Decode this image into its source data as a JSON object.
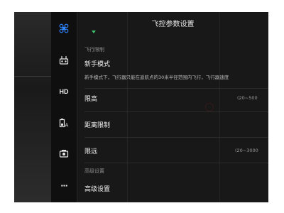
{
  "header": {
    "title": "飞控参数设置"
  },
  "sidebar": {
    "items": [
      {
        "icon": "drone-icon",
        "label": ""
      },
      {
        "icon": "remote-controller-icon",
        "label": ""
      },
      {
        "icon": "hd-icon",
        "label": "HD"
      },
      {
        "icon": "battery-icon",
        "label": ""
      },
      {
        "icon": "camera-icon",
        "label": ""
      },
      {
        "icon": "more-icon",
        "label": "···"
      }
    ]
  },
  "sections": {
    "flight_limits": "飞行限制",
    "advanced": "高级设置"
  },
  "rows": {
    "novice_mode": {
      "label": "新手模式",
      "desc": "新手模式下，飞行器只能在返航点的30米半径范围内飞行，飞行器速度"
    },
    "altitude_limit": {
      "label": "限高",
      "range": "(20~500"
    },
    "distance_limit": {
      "label": "距离限制"
    },
    "distance_limit_value": {
      "label": "限远",
      "range": "(20~3000"
    },
    "advanced_settings": {
      "label": "高级设置"
    }
  }
}
